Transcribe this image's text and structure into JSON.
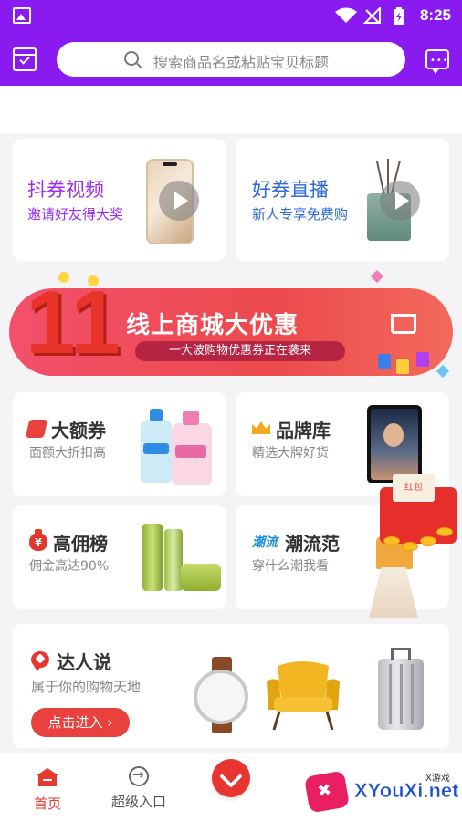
{
  "status_bar": {
    "time": "8:25"
  },
  "search": {
    "placeholder": "搜索商品名或粘贴宝贝标题"
  },
  "video_cards": [
    {
      "title": "抖券视频",
      "subtitle": "邀请好友得大奖",
      "title_color": "#9b2cf0",
      "subtitle_color": "#9b2cf0"
    },
    {
      "title": "好券直播",
      "subtitle": "新人专享免费购",
      "title_color": "#2f6ad8",
      "subtitle_color": "#2f6ad8"
    }
  ],
  "banner": {
    "title": "线上商城大优惠",
    "subtitle": "一大波购物优惠券正在袭来",
    "big_number": "11"
  },
  "categories": [
    {
      "title": "大额券",
      "subtitle": "面额大折扣高",
      "icon": "coupon-icon"
    },
    {
      "title": "品牌库",
      "subtitle": "精选大牌好货",
      "icon": "crown-icon"
    },
    {
      "title": "高佣榜",
      "subtitle": "佣金高达90%",
      "icon": "money-bag-icon",
      "icon_text": "¥"
    },
    {
      "title": "潮流范",
      "subtitle": "穿什么潮我看",
      "icon": "trend-icon",
      "icon_text": "潮流"
    }
  ],
  "red_packet": {
    "label": "红包"
  },
  "talent": {
    "title": "达人说",
    "subtitle": "属于你的购物天地",
    "button": "点击进入 ›"
  },
  "nav": [
    {
      "label": "首页",
      "active": true
    },
    {
      "label": "超级入口",
      "active": false
    }
  ],
  "watermark": {
    "site": "XYouXi.net",
    "small": "X游戏"
  },
  "colors": {
    "header": "#8a1bf0",
    "accent_red": "#e8352f",
    "banner_red": "#ec4a4c"
  }
}
